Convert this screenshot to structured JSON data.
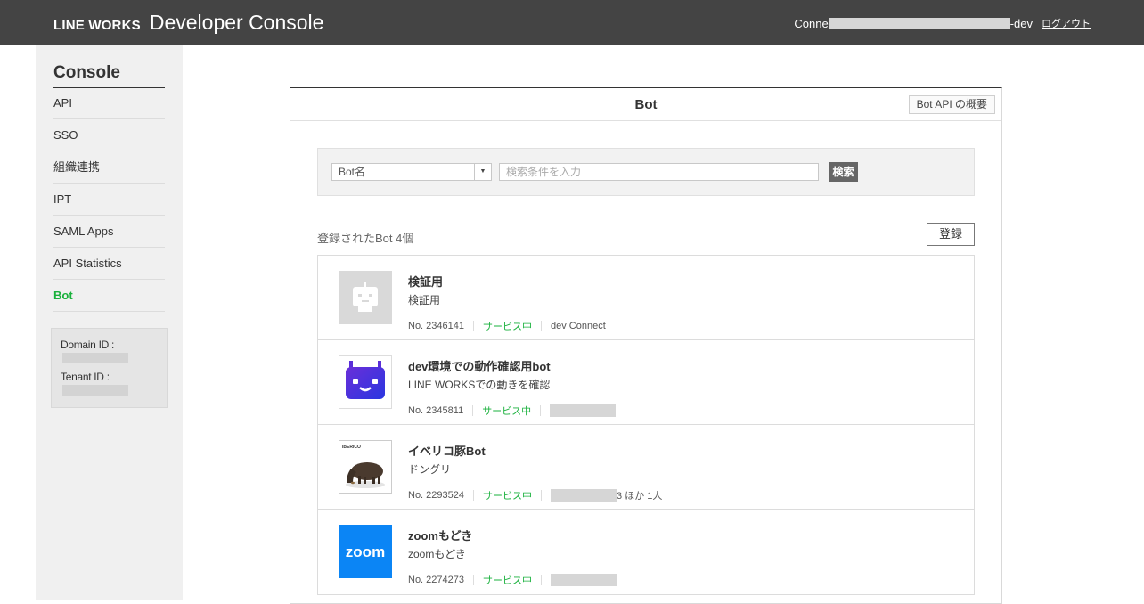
{
  "header": {
    "brand": "LINE WORKS",
    "title": "Developer Console",
    "user_prefix": "Conne",
    "user_suffix": "-dev",
    "logout": "ログアウト"
  },
  "sidebar": {
    "title": "Console",
    "items": [
      {
        "label": "API"
      },
      {
        "label": "SSO"
      },
      {
        "label": "組織連携"
      },
      {
        "label": "IPT"
      },
      {
        "label": "SAML Apps"
      },
      {
        "label": "API Statistics"
      },
      {
        "label": "Bot",
        "active": true
      }
    ],
    "domain_id_label": "Domain ID :",
    "tenant_id_label": "Tenant ID :"
  },
  "panel": {
    "title": "Bot",
    "api_overview_button": "Bot API の概要",
    "search": {
      "select_value": "Bot名",
      "placeholder": "検索条件を入力",
      "button": "検索"
    },
    "count_text": "登録されたBot 4個",
    "register_button": "登録",
    "bots": [
      {
        "name": "検証用",
        "desc": "検証用",
        "no": "No. 2346141",
        "status": "サービス中",
        "owner": "dev Connect",
        "icon": "robot-placeholder-icon"
      },
      {
        "name": "dev環境での動作確認用bot",
        "desc": "LINE WORKSでの動きを確認",
        "no": "No. 2345811",
        "status": "サービス中",
        "owner": "",
        "icon": "purple-robot-icon"
      },
      {
        "name": "イベリコ豚Bot",
        "desc": "ドングリ",
        "no": "No. 2293524",
        "status": "サービス中",
        "owner": "3 ほか 1人",
        "icon": "pig-photo-icon"
      },
      {
        "name": "zoomもどき",
        "desc": "zoomもどき",
        "no": "No. 2274273",
        "status": "サービス中",
        "owner": "",
        "icon": "zoom-logo-icon"
      }
    ],
    "pig_logo_text": "IBERICO",
    "zoom_logo_text": "zoom"
  },
  "colors": {
    "header_bg": "#444444",
    "accent_green": "#19b13c",
    "sidebar_bg": "#f0f0f0",
    "zoom_blue": "#0b85f5",
    "robot_purple": "#5a2ed8"
  }
}
